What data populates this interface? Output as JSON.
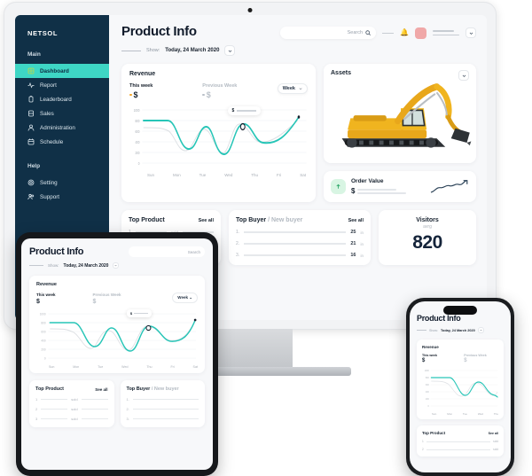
{
  "brand": "NETSOL",
  "sidebar": {
    "main_label": "Main",
    "help_label": "Help",
    "items": [
      {
        "label": "Dashboard",
        "icon": "dashboard-icon",
        "active": true
      },
      {
        "label": "Report",
        "icon": "report-icon",
        "active": false
      },
      {
        "label": "Leaderboard",
        "icon": "leaderboard-icon",
        "active": false
      },
      {
        "label": "Sales",
        "icon": "sales-icon",
        "active": false
      },
      {
        "label": "Administration",
        "icon": "administration-icon",
        "active": false
      },
      {
        "label": "Schedule",
        "icon": "schedule-icon",
        "active": false
      }
    ],
    "help_items": [
      {
        "label": "Setting",
        "icon": "gear-icon"
      },
      {
        "label": "Support",
        "icon": "support-icon"
      }
    ]
  },
  "header": {
    "title": "Product Info",
    "search_placeholder": "Search",
    "bell_icon": "bell-icon",
    "avatar": "avatar",
    "chevron_icon": "chevron-down-icon"
  },
  "filter": {
    "show_label": "Show:",
    "show_value": "Today, 24 March 2020"
  },
  "revenue": {
    "title": "Revenue",
    "this_week_label": "This week",
    "previous_week_label": "Previous Week",
    "this_week_amount": "$",
    "previous_week_amount": "$",
    "range_label": "Week",
    "tooltip_value": "$"
  },
  "chart_data": {
    "type": "line",
    "title": "Revenue",
    "xlabel": "",
    "ylabel": "",
    "categories": [
      "Sun",
      "Mon",
      "Tue",
      "Wed",
      "Thu",
      "Fri",
      "Sat"
    ],
    "yticks": [
      "1000",
      "800",
      "600",
      "400",
      "200",
      "0"
    ],
    "ylim": [
      0,
      1000
    ],
    "grid": true,
    "legend_position": "top-left",
    "series": [
      {
        "name": "This week",
        "color": "#27c5b7",
        "values": [
          800,
          300,
          640,
          220,
          690,
          450,
          820
        ]
      },
      {
        "name": "Previous Week",
        "color": "#d7dbe0",
        "values": [
          640,
          430,
          300,
          700,
          390,
          300,
          470
        ]
      }
    ]
  },
  "assets": {
    "title": "Assets",
    "chevron_icon": "chevron-down-icon",
    "image": "excavator-image"
  },
  "order_value": {
    "title": "Order Value",
    "amount": "$",
    "badge_icon": "arrow-up-icon",
    "spark": "sparkline-up"
  },
  "top_product": {
    "title": "Top Product",
    "see_all": "See all",
    "rows": [
      {
        "rank": "1",
        "unit": "sold"
      },
      {
        "rank": "2",
        "unit": "sold"
      },
      {
        "rank": "3",
        "unit": "sold"
      }
    ]
  },
  "top_buyer": {
    "title": "Top Buyer",
    "subtitle": "/ New buyer",
    "see_all": "See all",
    "rows": [
      {
        "rank": "1.",
        "value": "25",
        "unit": "in"
      },
      {
        "rank": "2.",
        "value": "21",
        "unit": "in"
      },
      {
        "rank": "3.",
        "value": "16",
        "unit": "in"
      }
    ]
  },
  "visitors": {
    "title": "Visitors",
    "subtitle": "avrg",
    "value": "820"
  },
  "colors": {
    "sidebar_bg": "#103047",
    "accent_teal": "#3ed6c5",
    "chart_line": "#27c5b7",
    "avatar_pink": "#f0a8a8",
    "badge_green": "#d8f5e3",
    "visitors_number": "#15243a"
  }
}
